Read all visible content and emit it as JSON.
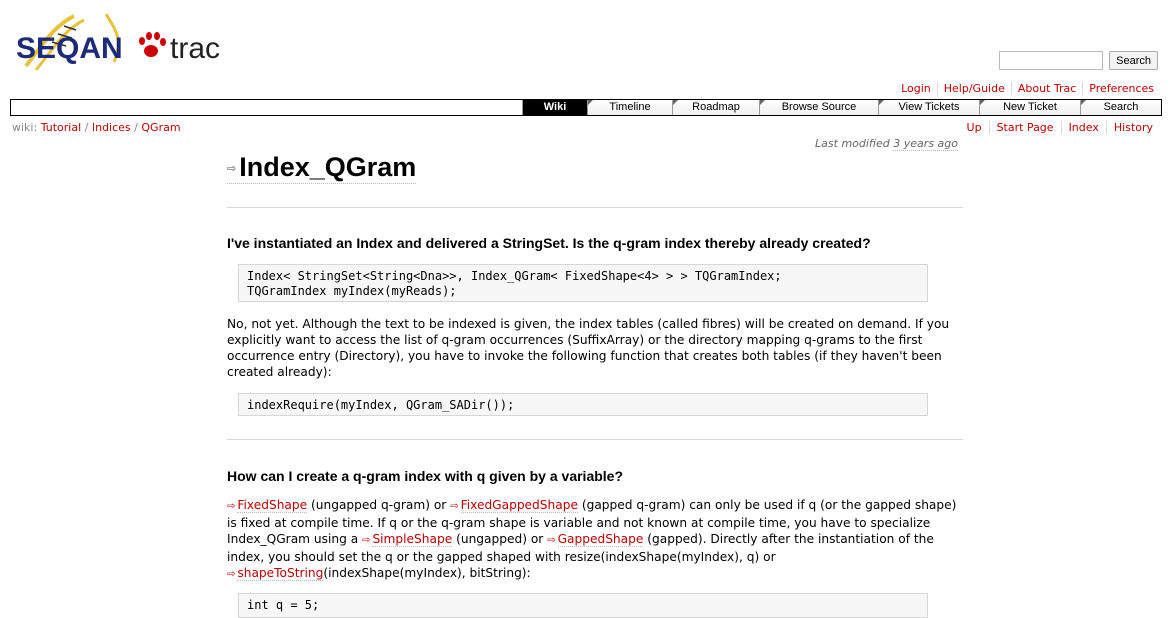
{
  "logo": {
    "text_left": "SEQAN",
    "text_right": "trac"
  },
  "search": {
    "placeholder": "",
    "button_label": "Search"
  },
  "metanav": [
    "Login",
    "Help/Guide",
    "About Trac",
    "Preferences"
  ],
  "mainnav": [
    {
      "label": "Wiki",
      "active": true
    },
    {
      "label": "Timeline",
      "active": false
    },
    {
      "label": "Roadmap",
      "active": false
    },
    {
      "label": "Browse Source",
      "active": false
    },
    {
      "label": "View Tickets",
      "active": false
    },
    {
      "label": "New Ticket",
      "active": false
    },
    {
      "label": "Search",
      "active": false
    }
  ],
  "breadcrumb": {
    "prefix": "wiki:",
    "items": [
      "Tutorial",
      "Indices",
      "QGram"
    ],
    "sep": "/"
  },
  "ctxtnav": [
    "Up",
    "Start Page",
    "Index",
    "History"
  ],
  "last_modified": {
    "prefix": "Last modified",
    "age": "3 years ago"
  },
  "page": {
    "title": "Index_QGram",
    "q1": "I've instantiated an Index and delivered a StringSet. Is the q-gram index thereby already created?",
    "code1_line1": "Index< StringSet<String<Dna>>, Index_QGram< FixedShape<4> > > TQGramIndex;",
    "code1_line2": "TQGramIndex myIndex(myReads);",
    "p1": "No, not yet. Although the text to be indexed is given, the index tables (called fibres) will be created on demand. If you explicitly want to access the list of q-gram occurrences (SuffixArray) or the directory mapping q-grams to the first occurrence entry (Directory), you have to invoke the following function that creates both tables (if they haven't been created already):",
    "code2": "indexRequire(myIndex, QGram_SADir());",
    "q2": "How can I create a q-gram index with q given by a variable?",
    "p2": {
      "link1": "FixedShape",
      "t1": " (ungapped q-gram) or ",
      "link2": "FixedGappedShape",
      "t2": " (gapped q-gram) can only be used if q (or the gapped shape) is fixed at compile time. If q or the q-gram shape is variable and not known at compile time, you have to specialize Index_QGram using a ",
      "link3": "SimpleShape",
      "t3": " (ungapped) or ",
      "link4": "GappedShape",
      "t4": " (gapped). Directly after the instantiation of the index, you should set the q or the gapped shaped with resize(indexShape(myIndex), q) or ",
      "link5": "shapeToString",
      "t5": "(indexShape(myIndex), bitString):"
    },
    "code3": "int q = 5;"
  }
}
